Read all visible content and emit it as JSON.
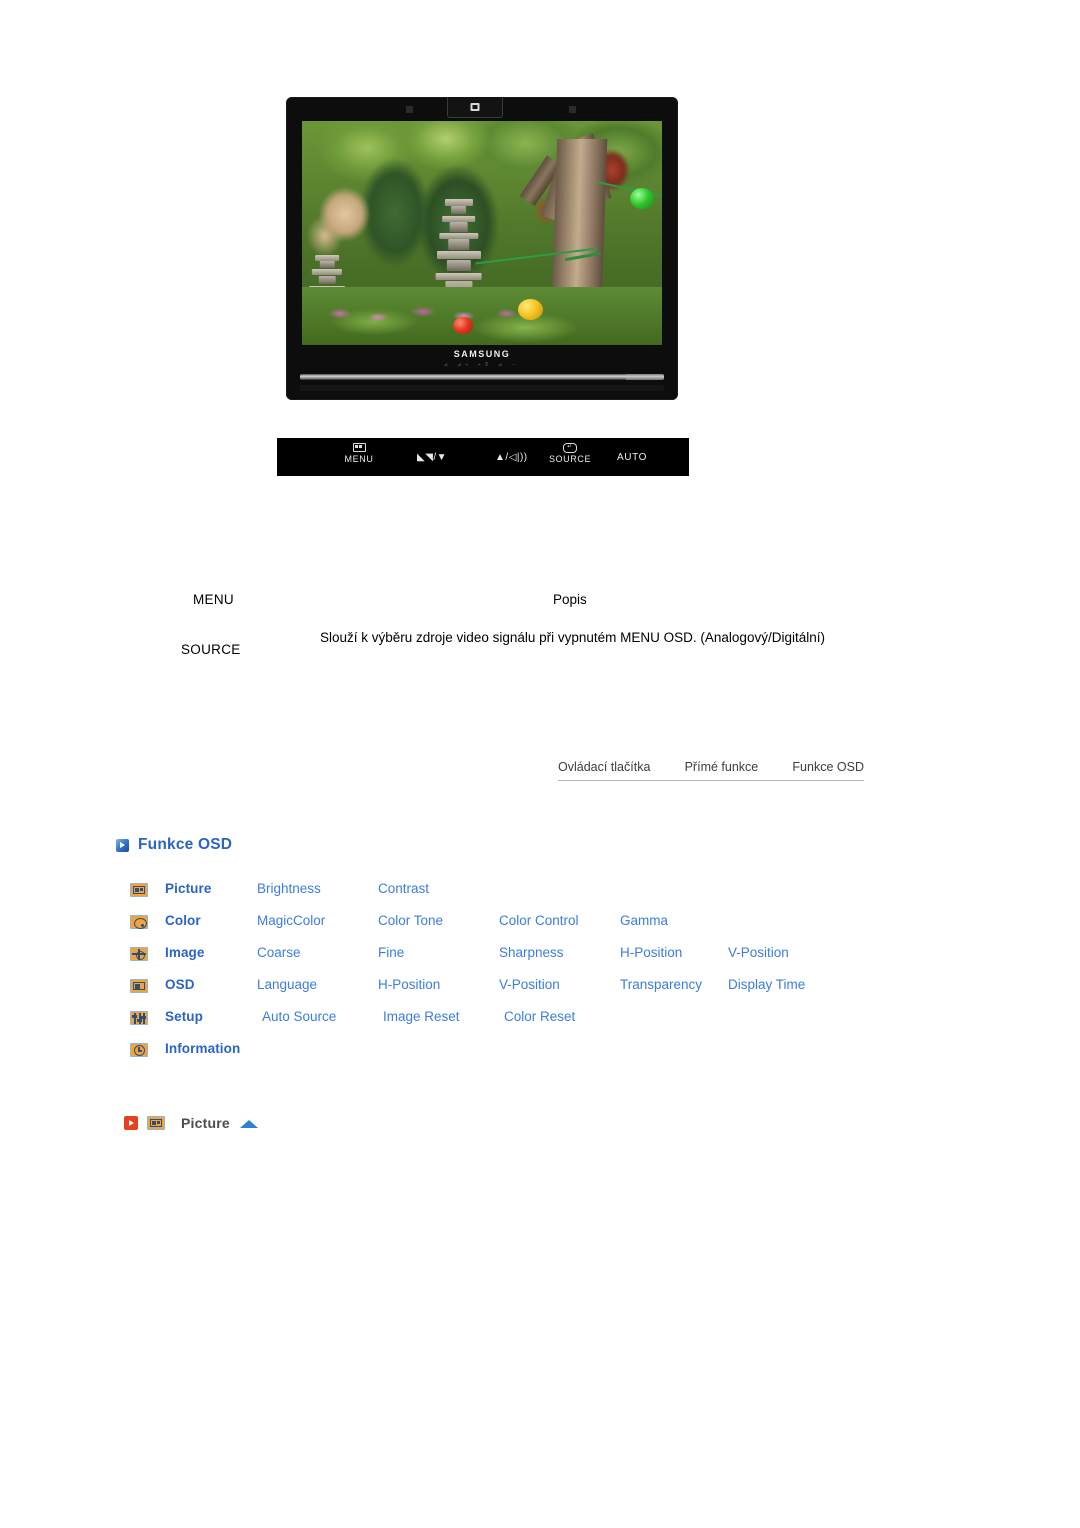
{
  "monitor": {
    "brand_logo": "SAMSUNG",
    "bezel_hint_glyphs": "⊿ ⊿⌁ ⌁⊽ ⊿ ⋯",
    "top_badge_icon": "power-indicator-icon"
  },
  "control_strip": {
    "buttons": [
      {
        "id": "menu",
        "glyph_icon": "menu-box-icon",
        "label": "MENU"
      },
      {
        "id": "bright",
        "glyph_icon": "brightness-down-icon",
        "label": "/▼",
        "prefix": "◣◥"
      },
      {
        "id": "volume",
        "glyph_icon": "volume-up-icon",
        "label": "▲/",
        "suffix": "◁|))"
      },
      {
        "id": "source",
        "glyph_icon": "source-enter-icon",
        "label": "SOURCE"
      },
      {
        "id": "auto",
        "glyph_icon": "",
        "label": "AUTO"
      }
    ]
  },
  "desc_table": {
    "header": {
      "menu": "MENU",
      "popis": "Popis"
    },
    "rows": [
      {
        "menu": "SOURCE",
        "desc": "Slouží k výběru zdroje video signálu při vypnutém MENU OSD. (Analogový/Digitální)"
      }
    ]
  },
  "tabs": [
    {
      "label": "Ovládací tlačítka",
      "active": false
    },
    {
      "label": "Přímé funkce",
      "active": false
    },
    {
      "label": "Funkce OSD",
      "active": true
    }
  ],
  "osd_section": {
    "heading": "Funkce OSD",
    "heading_icon": "blue-play-arrow-icon",
    "rows": [
      {
        "icon": "picture-icon",
        "category": "Picture",
        "items": [
          "Brightness",
          "Contrast"
        ]
      },
      {
        "icon": "color-palette-icon",
        "category": "Color",
        "items": [
          "MagicColor",
          "Color Tone",
          "Color Control",
          "Gamma"
        ]
      },
      {
        "icon": "image-adjust-icon",
        "category": "Image",
        "items": [
          "Coarse",
          "Fine",
          "Sharpness",
          "H-Position",
          "V-Position"
        ]
      },
      {
        "icon": "osd-window-icon",
        "category": "OSD",
        "items": [
          "Language",
          "H-Position",
          "V-Position",
          "Transparency",
          "Display Time"
        ]
      },
      {
        "icon": "setup-sliders-icon",
        "category": "Setup",
        "items": [
          "Auto Source",
          "Image Reset",
          "Color Reset"
        ]
      },
      {
        "icon": "information-clock-icon",
        "category": "Information",
        "items": []
      }
    ]
  },
  "picture_section": {
    "arrow_icon": "red-play-arrow-icon",
    "menu_icon": "picture-icon",
    "title": "Picture",
    "up_icon": "blue-up-triangle-icon"
  },
  "colors": {
    "heading_blue": "#2b63c7",
    "link_blue": "#3d7ce0",
    "accent_orange": "#f2a33c",
    "red_arrow": "#e8401f",
    "icon_outline": "#2b4f7a",
    "tab_text": "#3d3d3d",
    "rule": "#b5b5b5"
  }
}
